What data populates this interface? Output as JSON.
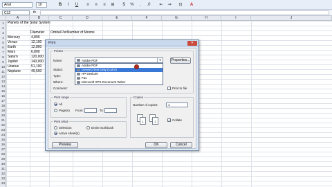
{
  "toolbar": {
    "font_name": "Arial",
    "font_size": "10",
    "buttons": [
      "B",
      "I",
      "U",
      "≡",
      "≡",
      "≡",
      "⊞",
      "$",
      "%",
      ",",
      ".0",
      "⇤",
      "⇥",
      "⊡",
      "A"
    ]
  },
  "formula_bar": {
    "name_box": "C12",
    "fx": "fx",
    "content": ""
  },
  "columns": [
    "A",
    "B",
    "C",
    "D",
    "E",
    "F",
    "G",
    "H",
    "I",
    "J"
  ],
  "rows": [
    "1",
    "2",
    "3",
    "4",
    "5",
    "6",
    "7",
    "8",
    "9",
    "10",
    "11",
    "12",
    "13",
    "14",
    "15",
    "16",
    "17",
    "18",
    "19",
    "20",
    "21",
    "22",
    "23",
    "24",
    "25",
    "26",
    "27",
    "28",
    "29",
    "30",
    "31",
    "32",
    "33",
    "34"
  ],
  "sheet": {
    "title": "Planets of the Solar System",
    "header_diameter": "Diameter",
    "header_rest": "Orbital PerNumber of Moons",
    "planets": [
      "Mercury",
      "Venus",
      "Earth",
      "Mars",
      "Saturn",
      "Jupiter",
      "Uranus",
      "Neptune"
    ],
    "diameters": [
      "4,800",
      "12,100",
      "12,800",
      "6,800",
      "120,000",
      "143,000",
      "51,100",
      "49,500"
    ]
  },
  "print_dialog": {
    "title": "Print",
    "printer_group": "Printer",
    "name_label": "Name:",
    "name_value": "Adobe PDF",
    "properties_button": "Properties...",
    "status_label": "Status:",
    "type_label": "Type:",
    "where_label": "Where:",
    "comment_label": "Comment:",
    "printer_options": [
      "Adobe PDF",
      "Generic/Text Only (Color)",
      "HP DeskJet",
      "Fax",
      "Microsoft XPS Document Writer"
    ],
    "print_to_file_label": "Print to file",
    "print_range_group": "Print range",
    "range_all": "All",
    "range_pages": "Page(s)",
    "from_label": "From:",
    "to_label": "To:",
    "print_what_group": "Print what",
    "what_selection": "Selection",
    "what_entire_workbook": "Entire workbook",
    "what_active_sheets": "Active sheet(s)",
    "copies_group": "Copies",
    "number_of_copies_label": "Number of copies:",
    "number_of_copies_value": "1",
    "collate_label": "Collate",
    "preview_button": "Preview",
    "ok_button": "OK",
    "cancel_button": "Cancel",
    "close_symbol": "✕",
    "selected_printer_index": 1
  },
  "colors": {
    "selection": "#3a78d8",
    "cursor": "#b83023"
  },
  "icons": [
    "bold-icon",
    "italic-icon",
    "underline-icon",
    "printer-icon",
    "close-icon",
    "chevron-down-icon",
    "page-icon"
  ]
}
